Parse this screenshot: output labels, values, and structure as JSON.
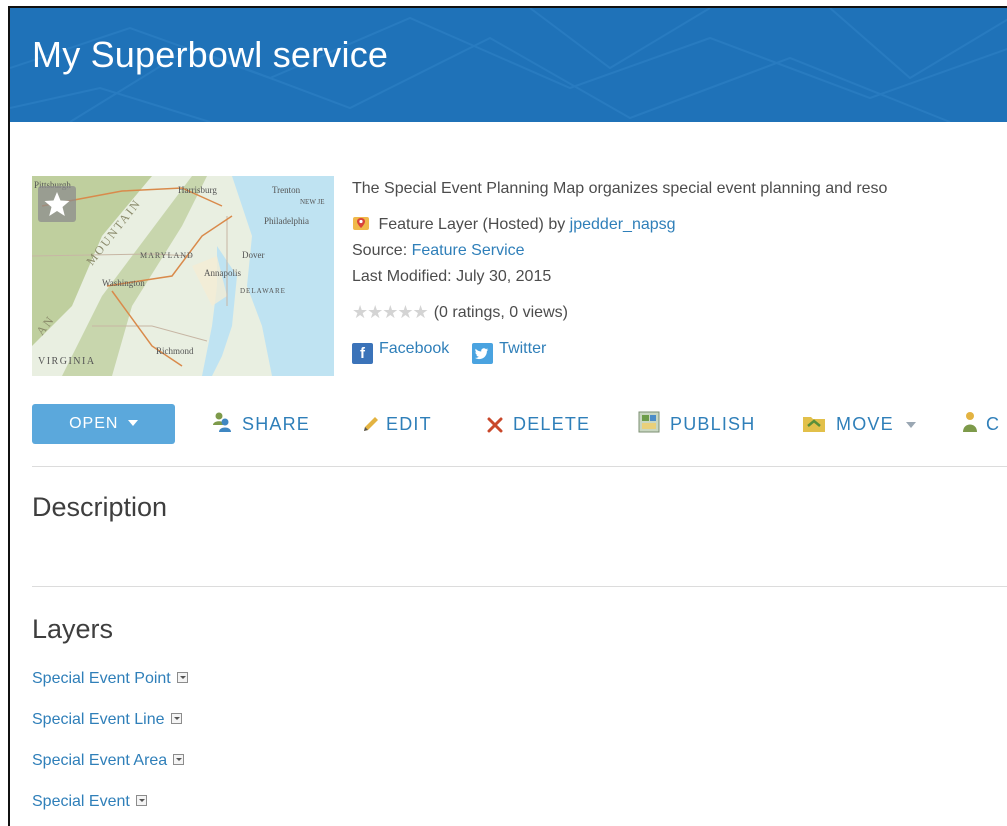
{
  "item": {
    "title": "My Superbowl service",
    "description": "The Special Event Planning Map organizes special event planning and reso",
    "type_label": "Feature Layer (Hosted)",
    "by_label": "by",
    "owner": "jpedder_napsg",
    "source_label": "Source:",
    "source_value": "Feature Service",
    "modified_label": "Last Modified:",
    "modified_value": "July 30, 2015",
    "rating_stars": 0,
    "ratings_text": "(0 ratings, 0 views)"
  },
  "share_links": {
    "facebook": "Facebook",
    "twitter": "Twitter"
  },
  "thumbnail": {
    "labels": [
      "Pittsburgh",
      "Harrisburg",
      "Trenton",
      "NEW JE",
      "Philadelphia",
      "MARYLAND",
      "Dover",
      "Annapolis",
      "Washington",
      "DELAWARE",
      "VIRGINIA",
      "Richmond",
      "MOUNTAIN",
      "AN"
    ]
  },
  "toolbar": {
    "open": "OPEN",
    "share": "SHARE",
    "edit": "EDIT",
    "delete": "DELETE",
    "publish": "PUBLISH",
    "move": "MOVE",
    "cut_off_icon": "C"
  },
  "sections": {
    "description_heading": "Description",
    "layers_heading": "Layers"
  },
  "layers": [
    "Special Event Point",
    "Special Event Line",
    "Special Event Area",
    "Special Event"
  ],
  "icons": {
    "favorite": "star-icon",
    "layer_type": "feature-layer-icon",
    "share": "share-users-icon",
    "edit": "pencil-icon",
    "delete": "x-icon",
    "publish": "publish-icon",
    "move": "folder-icon",
    "cut_off": "user-icon"
  },
  "colors": {
    "banner": "#1f72b8",
    "link": "#2f7fb9",
    "open_button": "#5ba8dc",
    "delete": "#c9482b"
  }
}
